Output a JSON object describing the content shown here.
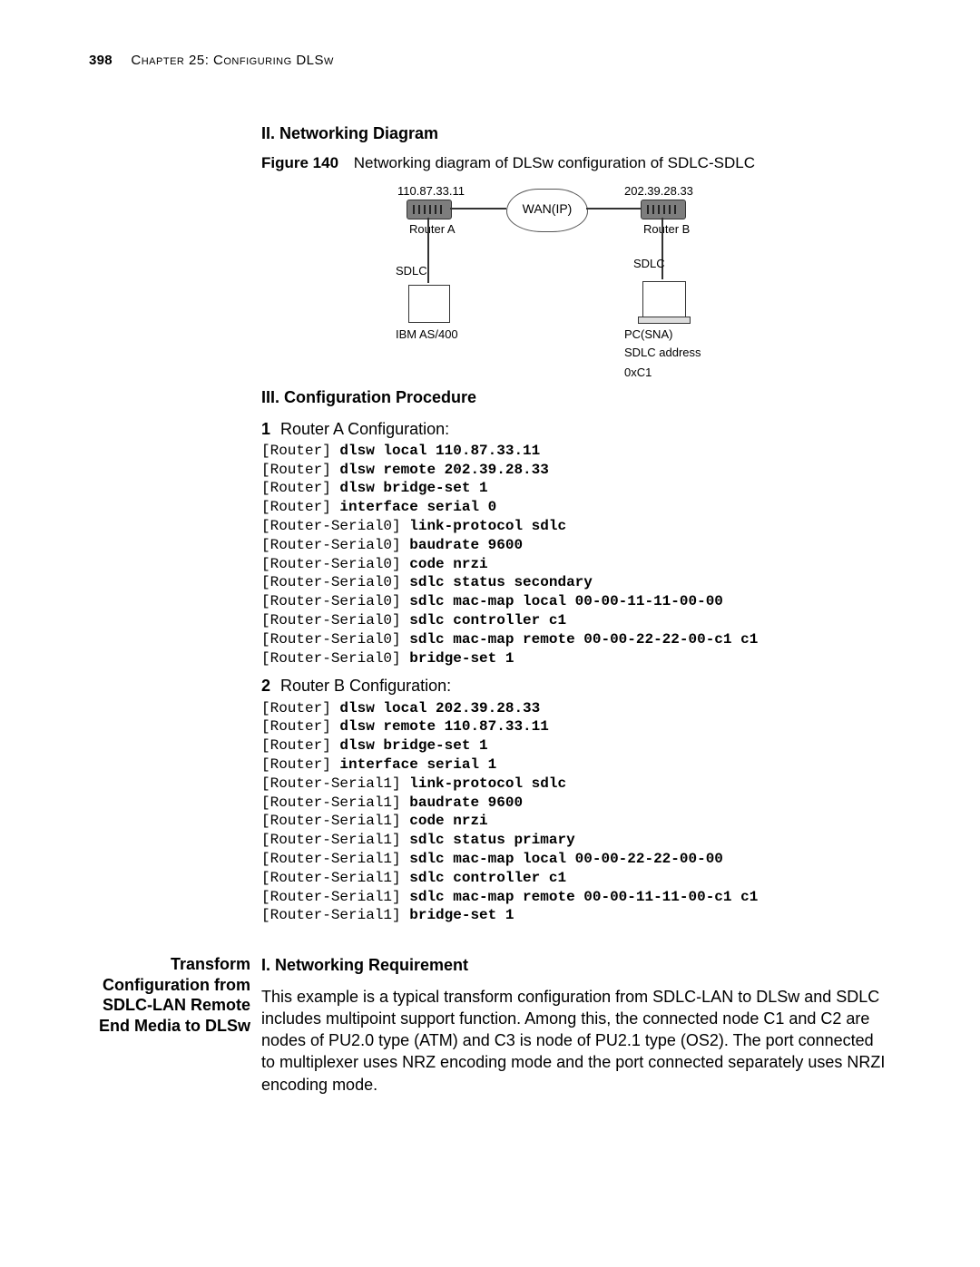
{
  "header": {
    "page_number": "398",
    "chapter_label": "Chapter 25: Configuring DLSw"
  },
  "section2": {
    "heading": "II. Networking Diagram",
    "figure_label": "Figure 140",
    "figure_caption": "Networking diagram of DLSw configuration of SDLC-SDLC"
  },
  "diagram": {
    "ip_a": "110.87.33.11",
    "ip_b": "202.39.28.33",
    "wan_label": "WAN(IP)",
    "router_a": "Router A",
    "router_b": "Router B",
    "sdlc_a": "SDLC",
    "sdlc_b": "SDLC",
    "device_a": "IBM AS/400",
    "device_b_line1": "PC(SNA)",
    "device_b_line2": "SDLC address",
    "device_b_line3": "0xC1"
  },
  "section3": {
    "heading": "III. Configuration Procedure",
    "step1_num": "1",
    "step1_text": "Router A Configuration:",
    "routerA": [
      {
        "prompt": "[Router]",
        "cmd": "dlsw local 110.87.33.11"
      },
      {
        "prompt": "[Router]",
        "cmd": "dlsw remote 202.39.28.33"
      },
      {
        "prompt": "[Router]",
        "cmd": "dlsw bridge-set 1"
      },
      {
        "prompt": "[Router]",
        "cmd": "interface serial 0"
      },
      {
        "prompt": "[Router-Serial0]",
        "cmd": "link-protocol sdlc"
      },
      {
        "prompt": "[Router-Serial0]",
        "cmd": "baudrate 9600"
      },
      {
        "prompt": "[Router-Serial0]",
        "cmd": "code nrzi"
      },
      {
        "prompt": "[Router-Serial0]",
        "cmd": "sdlc status secondary"
      },
      {
        "prompt": "[Router-Serial0]",
        "cmd": "sdlc mac-map local 00-00-11-11-00-00"
      },
      {
        "prompt": "[Router-Serial0]",
        "cmd": "sdlc controller c1"
      },
      {
        "prompt": "[Router-Serial0]",
        "cmd": "sdlc mac-map remote 00-00-22-22-00-c1 c1"
      },
      {
        "prompt": "[Router-Serial0]",
        "cmd": "bridge-set 1"
      }
    ],
    "step2_num": "2",
    "step2_text": "Router B Configuration:",
    "routerB": [
      {
        "prompt": "[Router]",
        "cmd": "dlsw local 202.39.28.33"
      },
      {
        "prompt": "[Router]",
        "cmd": "dlsw remote 110.87.33.11"
      },
      {
        "prompt": "[Router]",
        "cmd": "dlsw bridge-set 1"
      },
      {
        "prompt": "[Router]",
        "cmd": "interface serial 1"
      },
      {
        "prompt": "[Router-Serial1]",
        "cmd": "link-protocol sdlc"
      },
      {
        "prompt": "[Router-Serial1]",
        "cmd": "baudrate 9600"
      },
      {
        "prompt": "[Router-Serial1]",
        "cmd": "code nrzi"
      },
      {
        "prompt": "[Router-Serial1]",
        "cmd": "sdlc status primary"
      },
      {
        "prompt": "[Router-Serial1]",
        "cmd": "sdlc mac-map local 00-00-22-22-00-00"
      },
      {
        "prompt": "[Router-Serial1]",
        "cmd": "sdlc controller c1"
      },
      {
        "prompt": "[Router-Serial1]",
        "cmd": "sdlc mac-map remote 00-00-11-11-00-c1 c1"
      },
      {
        "prompt": "[Router-Serial1]",
        "cmd": "bridge-set 1"
      }
    ]
  },
  "section_transform": {
    "sidebar_title": "Transform Configuration from SDLC-LAN Remote End Media to DLSw",
    "heading": "I. Networking Requirement",
    "paragraph": "This example is a typical transform configuration from SDLC-LAN to DLSw and SDLC includes multipoint support function. Among this, the connected node C1 and C2 are nodes of PU2.0 type (ATM) and C3 is node of PU2.1 type (OS2). The port connected to multiplexer uses NRZ encoding mode and the port connected separately uses NRZI encoding mode."
  }
}
